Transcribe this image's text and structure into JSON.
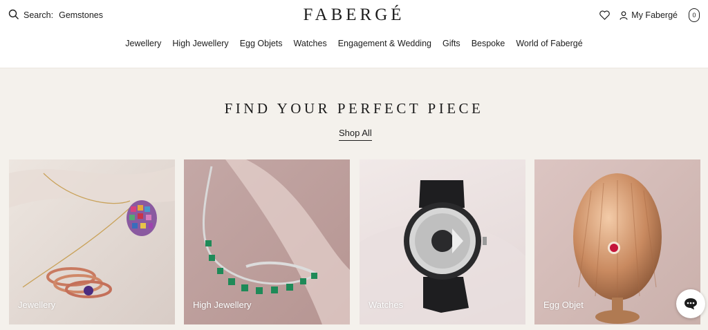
{
  "header": {
    "search_label": "Search:",
    "search_query": "Gemstones",
    "logo": "FABERGÉ",
    "account_label": "My Fabergé",
    "bag_count": "0"
  },
  "nav": [
    "Jewellery",
    "High Jewellery",
    "Egg Objets",
    "Watches",
    "Engagement & Wedding",
    "Gifts",
    "Bespoke",
    "World of Fabergé"
  ],
  "hero": {
    "heading": "FIND YOUR PERFECT PIECE",
    "cta": "Shop All"
  },
  "categories": [
    {
      "label": "Jewellery",
      "image": "necklace-and-rings"
    },
    {
      "label": "High Jewellery",
      "image": "emerald-necklace"
    },
    {
      "label": "Watches",
      "image": "black-watch"
    },
    {
      "label": "Egg Objet",
      "image": "gold-egg"
    }
  ],
  "colors": {
    "background": "#f4f1ec",
    "text": "#1c1c1c",
    "header_bg": "#ffffff"
  },
  "icons": [
    "search-icon",
    "heart-icon",
    "user-icon",
    "bag-icon",
    "chat-icon"
  ]
}
